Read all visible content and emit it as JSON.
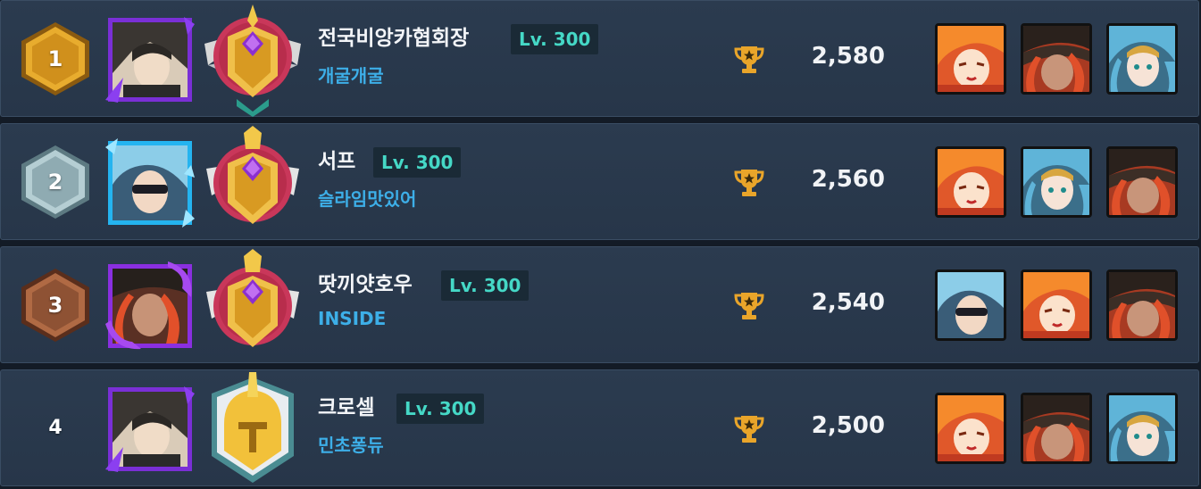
{
  "trophy_icon": "trophy-icon",
  "colors": {
    "row_bg": "#2b3b4f",
    "name": "#f3f5f8",
    "level": "#45d8c6",
    "guild": "#3dafe8",
    "gold_rank": "#d29a24",
    "silver_rank": "#9fb9c0",
    "bronze_rank": "#9c5a3a"
  },
  "players": [
    {
      "rank": "1",
      "rank_badge": "gold-hexagon",
      "name": "전국비앙카협회장",
      "level": "Lv. 300",
      "guild": "개굴개굴",
      "score": "2,580",
      "avatar": "dark-haired-heroine-purple-frame",
      "emblem": "winged-crest-purple-gem",
      "heroes": [
        "orange-haired-girl",
        "red-haired-hat-girl",
        "blue-haired-girl"
      ]
    },
    {
      "rank": "2",
      "rank_badge": "silver-hexagon",
      "name": "서프",
      "level": "Lv. 300",
      "guild": "슬라임맛있어",
      "score": "2,560",
      "avatar": "blue-haired-sunglasses-cyan-frame",
      "emblem": "crest-purple-gem",
      "heroes": [
        "orange-haired-girl",
        "blue-haired-girl",
        "red-haired-hat-girl"
      ]
    },
    {
      "rank": "3",
      "rank_badge": "bronze-hexagon",
      "name": "땃끼얏호우",
      "level": "Lv. 300",
      "guild": "INSIDE",
      "score": "2,540",
      "avatar": "red-haired-hat-purple-flame-frame",
      "emblem": "crest-purple-gem",
      "heroes": [
        "blue-haired-sunglasses",
        "orange-haired-girl",
        "red-haired-hat-girl"
      ]
    },
    {
      "rank": "4",
      "rank_badge": "none",
      "name": "크로셀",
      "level": "Lv. 300",
      "guild": "민초퐁듀",
      "score": "2,500",
      "avatar": "dark-haired-heroine-purple-frame",
      "emblem": "golden-spartan-helmet",
      "heroes": [
        "orange-haired-girl",
        "red-haired-hat-girl",
        "blue-haired-girl"
      ]
    }
  ]
}
